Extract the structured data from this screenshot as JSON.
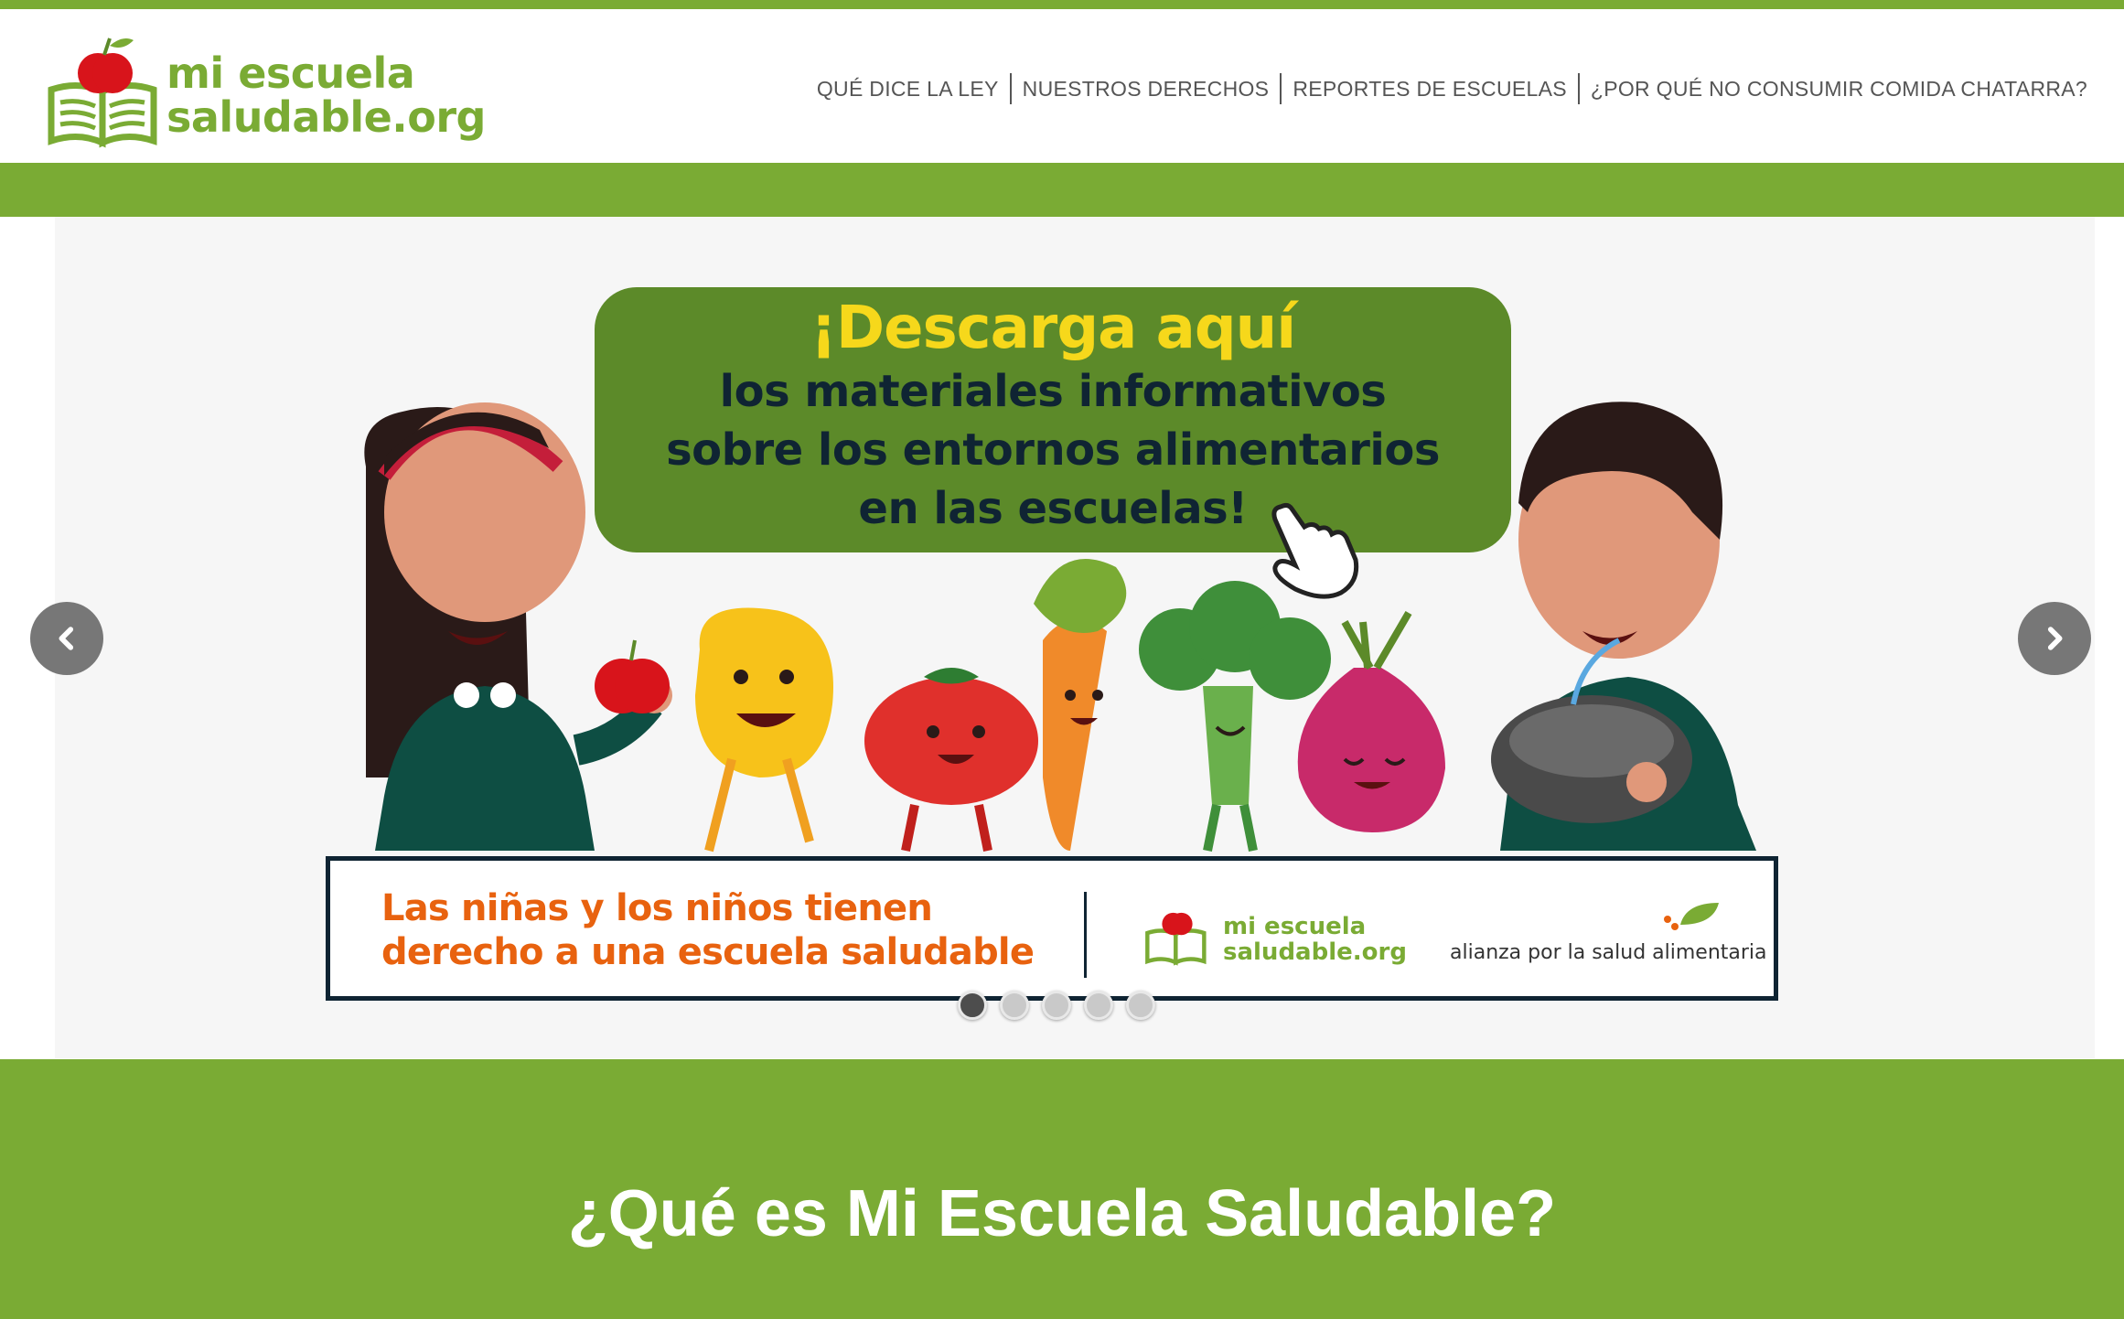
{
  "logo": {
    "line1": "mi escuela",
    "line2": "saludable.org"
  },
  "nav": {
    "items": [
      {
        "label": "QUÉ DICE LA LEY"
      },
      {
        "label": "NUESTROS DERECHOS"
      },
      {
        "label": "REPORTES DE ESCUELAS"
      },
      {
        "label": "¿POR QUÉ NO CONSUMIR COMIDA CHATARRA?"
      }
    ]
  },
  "slide": {
    "headline": "¡Descarga aquí",
    "line1": "los materiales informativos",
    "line2": "sobre los entornos alimentarios",
    "line3": "en las escuelas!",
    "slogan_line1": "Las niñas y los niños tienen",
    "slogan_line2": "derecho a una escuela saludable",
    "mini_logo_line1": "mi escuela",
    "mini_logo_line2": "saludable.org",
    "partner": "alianza por la salud alimentaria"
  },
  "slider": {
    "slide_count": 5,
    "active_index": 0
  },
  "section": {
    "title": "¿Qué es Mi Escuela Saludable?"
  },
  "colors": {
    "brand_green": "#7aab34",
    "bubble_green": "#5c8a29",
    "headline_yellow": "#f6d81b",
    "slogan_orange": "#e8620f",
    "navy": "#0f2433"
  }
}
